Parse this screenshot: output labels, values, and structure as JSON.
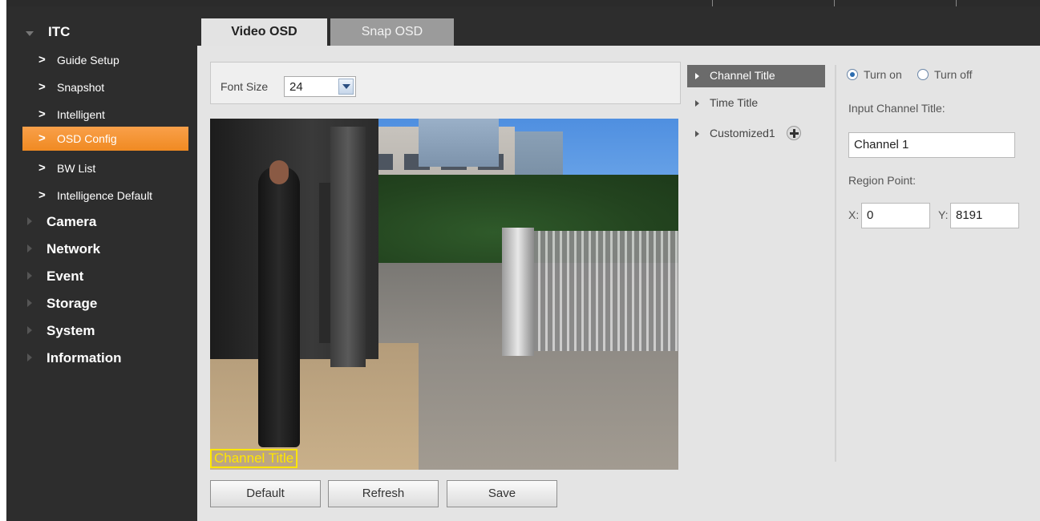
{
  "sidebar": {
    "top_group": {
      "label": "ITC",
      "items": [
        {
          "label": "Guide Setup"
        },
        {
          "label": "Snapshot"
        },
        {
          "label": "Intelligent"
        },
        {
          "label": "OSD Config",
          "active": true
        },
        {
          "label": "BW List"
        },
        {
          "label": "Intelligence Default"
        }
      ]
    },
    "groups": [
      {
        "label": "Camera"
      },
      {
        "label": "Network"
      },
      {
        "label": "Event"
      },
      {
        "label": "Storage"
      },
      {
        "label": "System"
      },
      {
        "label": "Information"
      }
    ],
    "chevron": ">"
  },
  "tabs": [
    {
      "label": "Video OSD",
      "active": true
    },
    {
      "label": "Snap OSD",
      "active": false
    }
  ],
  "font_size": {
    "label": "Font Size",
    "value": "24"
  },
  "video": {
    "osd_label": "Channel Title"
  },
  "buttons": {
    "default": "Default",
    "refresh": "Refresh",
    "save": "Save"
  },
  "osd_items": [
    {
      "label": "Channel Title",
      "active": true
    },
    {
      "label": "Time Title",
      "active": false
    },
    {
      "label": "Customized1",
      "active": false
    }
  ],
  "channel_props": {
    "turn_on": "Turn on",
    "turn_off": "Turn off",
    "selected": "Turn on",
    "input_title_label": "Input Channel Title:",
    "title_value": "Channel 1",
    "region_label": "Region Point:",
    "x_label": "X:",
    "x_value": "0",
    "y_label": "Y:",
    "y_value": "8191"
  },
  "colors": {
    "accent_active": "#f08a22",
    "sidebar_bg": "#2d2d2d",
    "osd_label": "#ffe600"
  }
}
